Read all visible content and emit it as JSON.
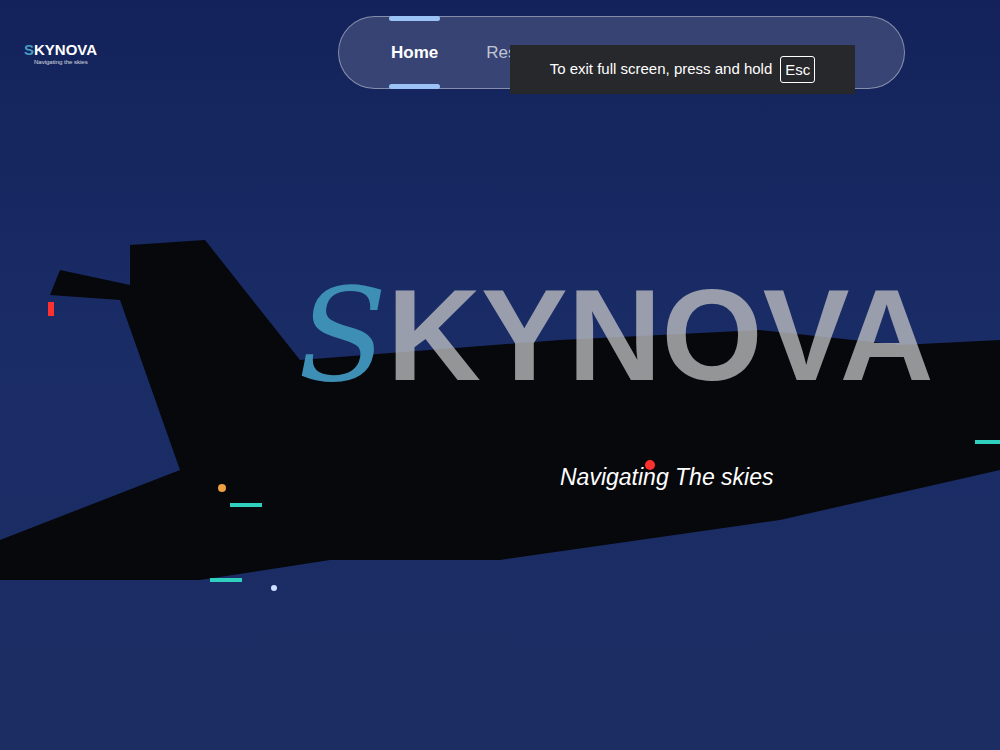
{
  "logo": {
    "text": "SKYNOVA",
    "tagline": "Navigating the skies"
  },
  "nav": {
    "items": [
      {
        "label": "Home",
        "selected": true
      },
      {
        "label": "Res",
        "selected": false
      }
    ]
  },
  "hero": {
    "title": "SKYNOVA",
    "subtitle": "Navigating The skies"
  },
  "fullscreen_notice": {
    "text": "To exit full screen, press and hold",
    "key": "Esc"
  }
}
